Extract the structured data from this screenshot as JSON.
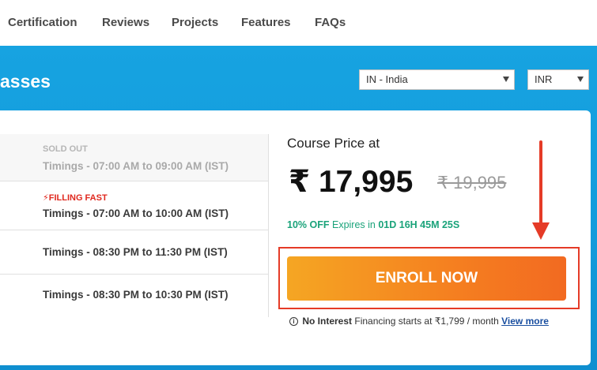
{
  "nav": {
    "items": [
      "Certification",
      "Reviews",
      "Projects",
      "Features",
      "FAQs"
    ]
  },
  "hero": {
    "title_fragment": "asses",
    "country_select": {
      "value": "IN - India"
    },
    "currency_select": {
      "value": "INR"
    }
  },
  "timings": [
    {
      "tag": "SOLD OUT",
      "label": "Timings - 07:00 AM to 09:00 AM (IST)",
      "status": "soldout"
    },
    {
      "tag": "FILLING FAST",
      "label": "Timings - 07:00 AM to 10:00 AM (IST)",
      "status": "fast"
    },
    {
      "tag": "",
      "label": "Timings - 08:30 PM to 11:30 PM (IST)",
      "status": "normal"
    },
    {
      "tag": "",
      "label": "Timings - 08:30 PM to 10:30 PM (IST)",
      "status": "normal"
    }
  ],
  "price": {
    "label": "Course Price at",
    "current": "₹ 17,995",
    "original": "₹ 19,995",
    "discount_pct": "10% OFF",
    "expires_text": "Expires in",
    "countdown": "01D 16H 45M 25S"
  },
  "enroll": {
    "button_label": "ENROLL NOW"
  },
  "financing": {
    "icon": "i",
    "strong": "No Interest",
    "text": "Financing starts at",
    "amount": "₹1,799 / month",
    "link": "View more"
  },
  "colors": {
    "hero_blue": "#17a3e1",
    "enroll_orange": "#f57f20",
    "discount_green": "#1aa37a",
    "annotation_red": "#e53b27",
    "filling_fast_red": "#e0281e"
  }
}
